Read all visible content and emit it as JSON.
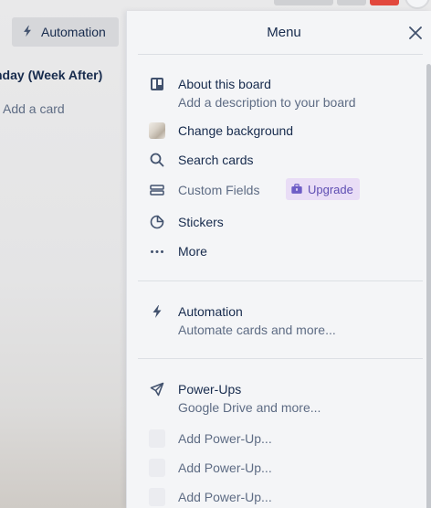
{
  "board": {
    "automation_button": "Automation",
    "list_title": "nday (Week After)",
    "add_card": "Add a card"
  },
  "menu": {
    "title": "Menu",
    "items": [
      {
        "label": "About this board",
        "sub": "Add a description to your board",
        "icon": "board-icon"
      },
      {
        "label": "Change background",
        "icon": "background-thumbnail"
      },
      {
        "label": "Search cards",
        "icon": "search-icon"
      },
      {
        "label": "Custom Fields",
        "icon": "custom-fields-icon",
        "badge": "Upgrade"
      },
      {
        "label": "Stickers",
        "icon": "sticker-icon"
      },
      {
        "label": "More",
        "icon": "more-icon"
      }
    ],
    "automation": {
      "label": "Automation",
      "sub": "Automate cards and more...",
      "icon": "lightning-icon"
    },
    "powerups": {
      "label": "Power-Ups",
      "sub": "Google Drive and more...",
      "icon": "rocket-icon"
    },
    "add_powerups": [
      "Add Power-Up...",
      "Add Power-Up...",
      "Add Power-Up..."
    ]
  },
  "colors": {
    "panel_bg": "#f4f5f7",
    "text": "#172b4d",
    "subtext": "#5e6c84",
    "upgrade_bg": "#e9ddf6",
    "upgrade_text": "#5e4db2",
    "top_red": "#e2483d"
  }
}
